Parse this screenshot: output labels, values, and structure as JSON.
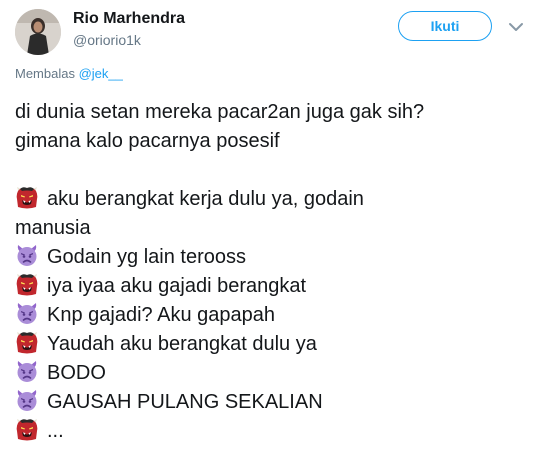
{
  "author": {
    "name": "Rio Marhendra",
    "handle": "@oriorio1k"
  },
  "follow_button": {
    "label": "Ikuti"
  },
  "more_icon": "chevron-down-icon",
  "reply_context": {
    "prefix": "Membalas",
    "mention": "@jek__"
  },
  "tweet_lines": [
    {
      "emoji": null,
      "text": "di dunia setan mereka pacar2an juga gak sih?"
    },
    {
      "emoji": null,
      "text": "gimana kalo pacarnya posesif"
    },
    {
      "emoji": null,
      "text": ""
    },
    {
      "emoji": "ogre",
      "text": "aku berangkat kerja dulu ya, godain"
    },
    {
      "emoji": null,
      "text": "manusia"
    },
    {
      "emoji": "angry-devil",
      "text": "Godain yg lain terooss"
    },
    {
      "emoji": "ogre",
      "text": "iya iyaa aku gajadi berangkat"
    },
    {
      "emoji": "angry-devil",
      "text": "Knp gajadi? Aku gapapah"
    },
    {
      "emoji": "ogre",
      "text": "Yaudah aku berangkat dulu ya"
    },
    {
      "emoji": "angry-devil",
      "text": "BODO"
    },
    {
      "emoji": "angry-devil",
      "text": "GAUSAH PULANG SEKALIAN"
    },
    {
      "emoji": "ogre",
      "text": "..."
    }
  ],
  "colors": {
    "accent": "#1da1f2",
    "muted": "#657786",
    "text": "#14171a",
    "ogre": "#c1272d",
    "devil": "#9266cc"
  }
}
